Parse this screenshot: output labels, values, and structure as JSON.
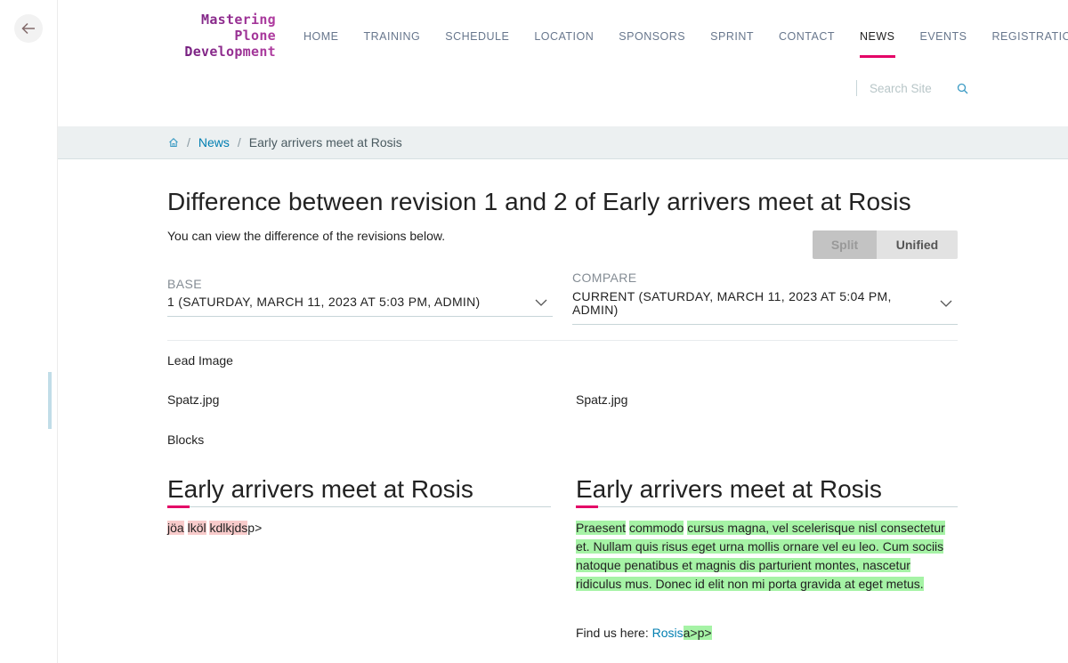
{
  "toolbar": {
    "back_label": "Back"
  },
  "logo": {
    "lines": [
      "Mastering",
      "Plone",
      "Development"
    ]
  },
  "nav": {
    "items": [
      {
        "label": "HOME",
        "active": false
      },
      {
        "label": "TRAINING",
        "active": false
      },
      {
        "label": "SCHEDULE",
        "active": false
      },
      {
        "label": "LOCATION",
        "active": false
      },
      {
        "label": "SPONSORS",
        "active": false
      },
      {
        "label": "SPRINT",
        "active": false
      },
      {
        "label": "CONTACT",
        "active": false
      },
      {
        "label": "NEWS",
        "active": true
      },
      {
        "label": "EVENTS",
        "active": false
      },
      {
        "label": "REGISTRATION",
        "active": false
      }
    ],
    "accent_color": "#e40166"
  },
  "search": {
    "placeholder": "Search Site",
    "value": ""
  },
  "breadcrumbs": {
    "home_icon": "home-icon",
    "items": [
      {
        "label": "News",
        "link": true
      },
      {
        "label": "Early arrivers meet at Rosis",
        "link": false
      }
    ]
  },
  "page": {
    "title": "Difference between revision 1 and 2 of Early arrivers meet at Rosis",
    "description": "You can view the difference of the revisions below.",
    "view_toggle": {
      "split_label": "Split",
      "unified_label": "Unified",
      "selected": "Split"
    }
  },
  "selectors": {
    "base": {
      "label": "BASE",
      "value": "1 (SATURDAY, MARCH 11, 2023 AT 5:03 PM,  ADMIN)"
    },
    "compare": {
      "label": "COMPARE",
      "value": "CURRENT (SATURDAY, MARCH 11, 2023 AT 5:04 PM,  ADMIN)"
    }
  },
  "fields": {
    "lead_image": {
      "label": "Lead Image",
      "base": "Spatz.jpg",
      "compare": "Spatz.jpg"
    },
    "blocks": {
      "label": "Blocks"
    }
  },
  "diff": {
    "base": {
      "title": "Early arrivers meet at Rosis",
      "removed": [
        "jöa",
        "lköl",
        "kdlkjds"
      ],
      "trailing": "p>"
    },
    "compare": {
      "title": "Early arrivers meet at Rosis",
      "added": [
        "Praesent",
        "commodo",
        "cursus magna, vel scelerisque nisl consectetur et. Nullam quis risus eget urna mollis ornare vel eu leo. Cum sociis natoque penatibus et magnis dis parturient montes, nascetur ridiculus mus. Donec id elit non mi porta gravida at eget metus."
      ],
      "find_us_label": "Find us here: ",
      "find_us_link": "Rosis",
      "find_us_added": "a>p>"
    },
    "colors": {
      "removed": "#f8cbcb",
      "added": "#a6f3a6"
    }
  }
}
